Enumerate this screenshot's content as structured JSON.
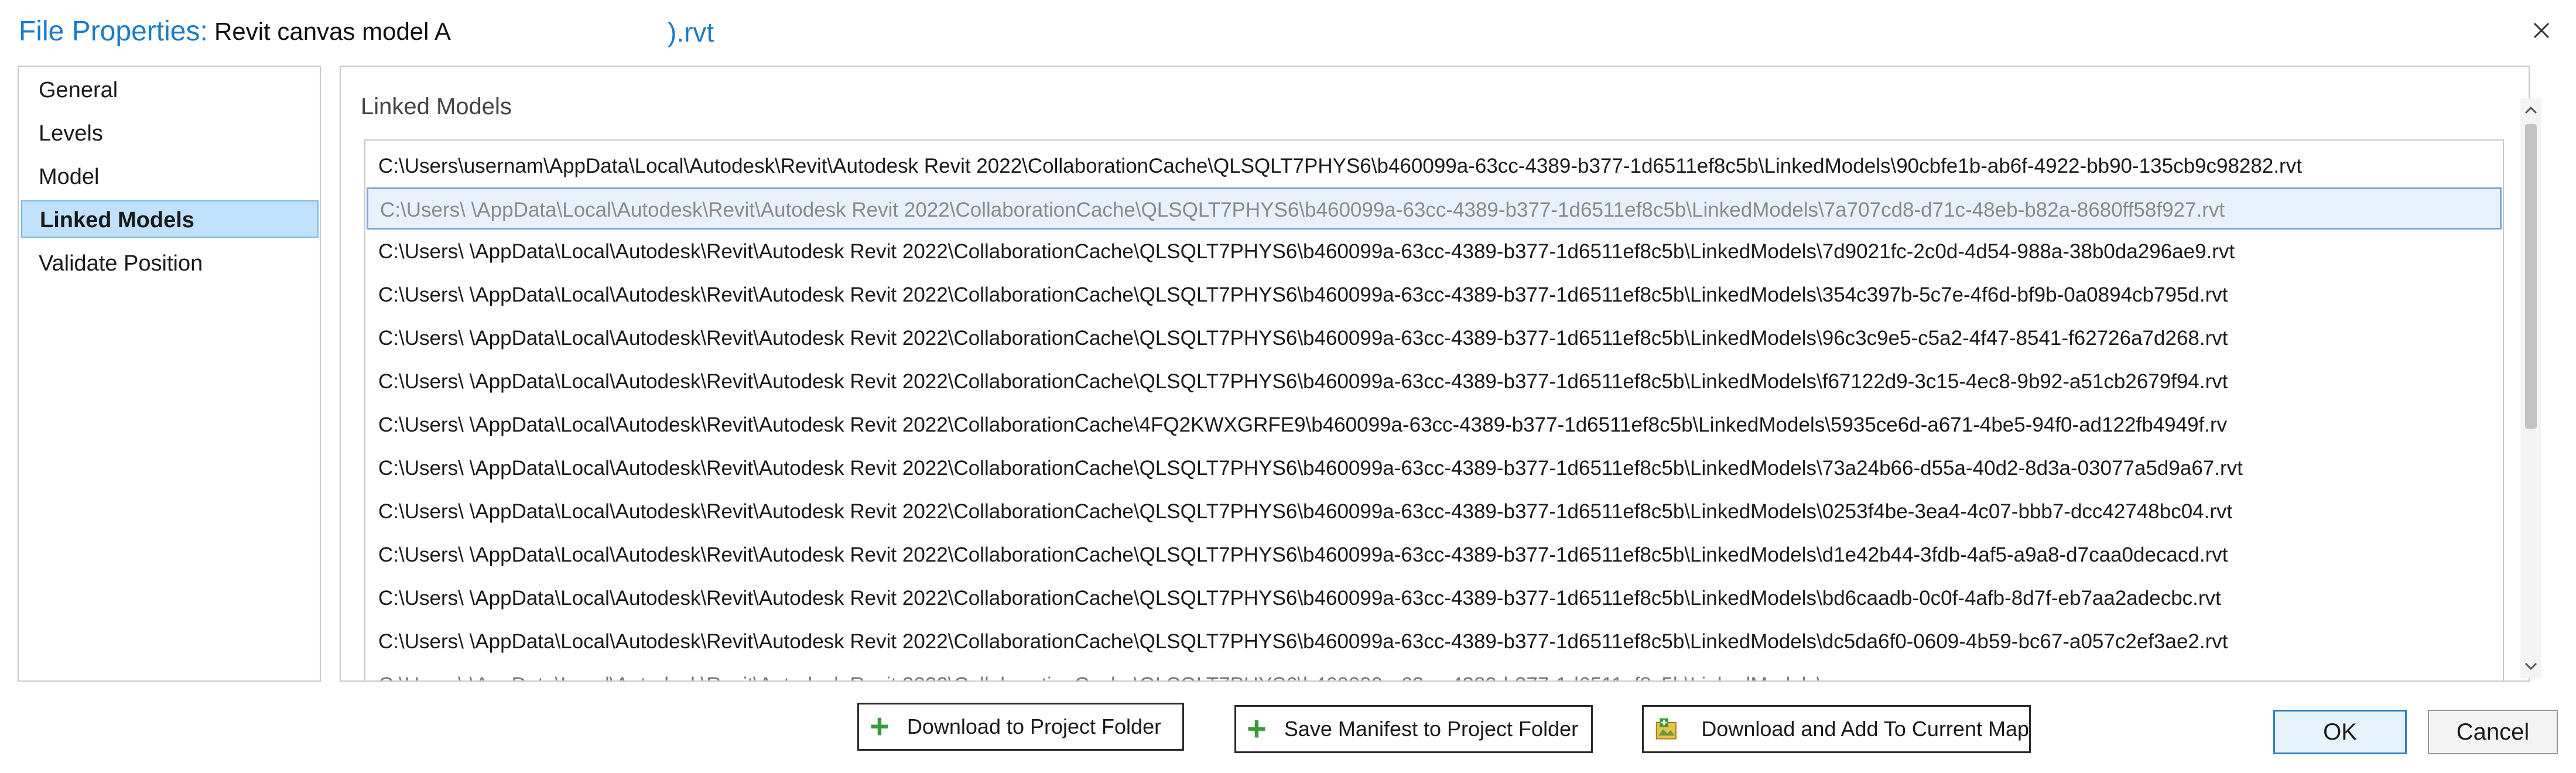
{
  "window": {
    "title_prefix": "File Properties:",
    "model_name": "Revit canvas model A",
    "title_extension": ").rvt",
    "close_icon": "close-icon"
  },
  "nav": {
    "items": [
      {
        "label": "General",
        "selected": false
      },
      {
        "label": "Levels",
        "selected": false
      },
      {
        "label": "Model",
        "selected": false
      },
      {
        "label": "Linked Models",
        "selected": true
      },
      {
        "label": "Validate Position",
        "selected": false
      }
    ]
  },
  "main": {
    "section_title": "Linked Models",
    "selected_index": 1,
    "rows": [
      "C:\\Users\\usernam\\AppData\\Local\\Autodesk\\Revit\\Autodesk Revit 2022\\CollaborationCache\\QLSQLT7PHYS6\\b460099a-63cc-4389-b377-1d6511ef8c5b\\LinkedModels\\90cbfe1b-ab6f-4922-bb90-135cb9c98282.rvt",
      "C:\\Users\\          \\AppData\\Local\\Autodesk\\Revit\\Autodesk Revit 2022\\CollaborationCache\\QLSQLT7PHYS6\\b460099a-63cc-4389-b377-1d6511ef8c5b\\LinkedModels\\7a707cd8-d71c-48eb-b82a-8680ff58f927.rvt",
      "C:\\Users\\          \\AppData\\Local\\Autodesk\\Revit\\Autodesk Revit 2022\\CollaborationCache\\QLSQLT7PHYS6\\b460099a-63cc-4389-b377-1d6511ef8c5b\\LinkedModels\\7d9021fc-2c0d-4d54-988a-38b0da296ae9.rvt",
      "C:\\Users\\          \\AppData\\Local\\Autodesk\\Revit\\Autodesk Revit 2022\\CollaborationCache\\QLSQLT7PHYS6\\b460099a-63cc-4389-b377-1d6511ef8c5b\\LinkedModels\\354c397b-5c7e-4f6d-bf9b-0a0894cb795d.rvt",
      "C:\\Users\\          \\AppData\\Local\\Autodesk\\Revit\\Autodesk Revit 2022\\CollaborationCache\\QLSQLT7PHYS6\\b460099a-63cc-4389-b377-1d6511ef8c5b\\LinkedModels\\96c3c9e5-c5a2-4f47-8541-f62726a7d268.rvt",
      "C:\\Users\\          \\AppData\\Local\\Autodesk\\Revit\\Autodesk Revit 2022\\CollaborationCache\\QLSQLT7PHYS6\\b460099a-63cc-4389-b377-1d6511ef8c5b\\LinkedModels\\f67122d9-3c15-4ec8-9b92-a51cb2679f94.rvt",
      "C:\\Users\\                 \\AppData\\Local\\Autodesk\\Revit\\Autodesk Revit 2022\\CollaborationCache\\4FQ2KWXGRFE9\\b460099a-63cc-4389-b377-1d6511ef8c5b\\LinkedModels\\5935ce6d-a671-4be5-94f0-ad122fb4949f.rv",
      "C:\\Users\\          \\AppData\\Local\\Autodesk\\Revit\\Autodesk Revit 2022\\CollaborationCache\\QLSQLT7PHYS6\\b460099a-63cc-4389-b377-1d6511ef8c5b\\LinkedModels\\73a24b66-d55a-40d2-8d3a-03077a5d9a67.rvt",
      "C:\\Users\\          \\AppData\\Local\\Autodesk\\Revit\\Autodesk Revit 2022\\CollaborationCache\\QLSQLT7PHYS6\\b460099a-63cc-4389-b377-1d6511ef8c5b\\LinkedModels\\0253f4be-3ea4-4c07-bbb7-dcc42748bc04.rvt",
      "C:\\Users\\          \\AppData\\Local\\Autodesk\\Revit\\Autodesk Revit 2022\\CollaborationCache\\QLSQLT7PHYS6\\b460099a-63cc-4389-b377-1d6511ef8c5b\\LinkedModels\\d1e42b44-3fdb-4af5-a9a8-d7caa0decacd.rvt",
      "C:\\Users\\          \\AppData\\Local\\Autodesk\\Revit\\Autodesk Revit 2022\\CollaborationCache\\QLSQLT7PHYS6\\b460099a-63cc-4389-b377-1d6511ef8c5b\\LinkedModels\\bd6caadb-0c0f-4afb-8d7f-eb7aa2adecbc.rvt",
      "C:\\Users\\          \\AppData\\Local\\Autodesk\\Revit\\Autodesk Revit 2022\\CollaborationCache\\QLSQLT7PHYS6\\b460099a-63cc-4389-b377-1d6511ef8c5b\\LinkedModels\\dc5da6f0-0609-4b59-bc67-a057c2ef3ae2.rvt",
      "C:\\Users\\          \\AppData\\Local\\Autodesk\\Revit\\Autodesk Revit 2022\\CollaborationCache\\QLSQLT7PHYS6\\b460099a-63cc-4389-b377-1d6511ef8c5b\\LinkedModels\\..."
    ]
  },
  "buttons": {
    "download_to_project": "Download to Project Folder",
    "save_manifest": "Save Manifest to Project Folder",
    "download_add_map": "Download and Add To Current Map",
    "ok": "OK",
    "cancel": "Cancel"
  },
  "icons": {
    "plus": "plus-icon",
    "map_add": "add-to-map-icon",
    "scroll_up": "chevron-up-icon",
    "scroll_down": "chevron-down-icon"
  },
  "colors": {
    "accent": "#1a7bc8",
    "selection": "#bfe1fb",
    "plus": "#3a9a3a"
  }
}
